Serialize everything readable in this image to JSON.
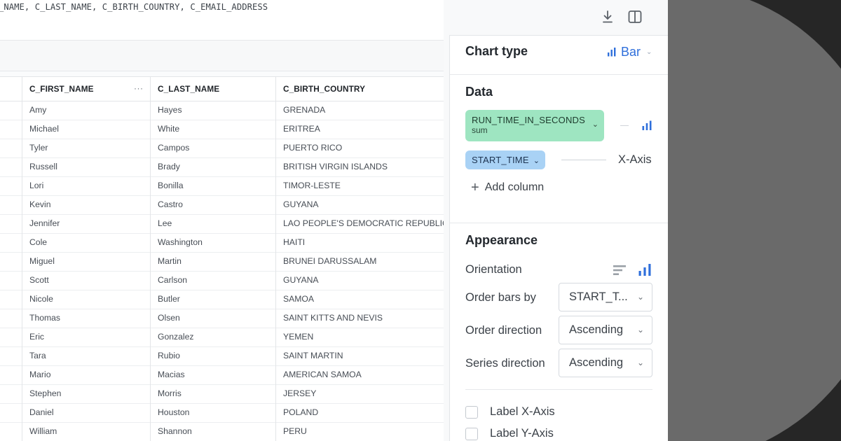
{
  "sql": {
    "text": "_NAME, C_LAST_NAME, C_BIRTH_COUNTRY, C_EMAIL_ADDRESS"
  },
  "table": {
    "columns": [
      "C_FIRST_NAME",
      "C_LAST_NAME",
      "C_BIRTH_COUNTRY"
    ],
    "rows": [
      [
        "Amy",
        "Hayes",
        "GRENADA"
      ],
      [
        "Michael",
        "White",
        "ERITREA"
      ],
      [
        "Tyler",
        "Campos",
        "PUERTO RICO"
      ],
      [
        "Russell",
        "Brady",
        "BRITISH VIRGIN ISLANDS"
      ],
      [
        "Lori",
        "Bonilla",
        "TIMOR-LESTE"
      ],
      [
        "Kevin",
        "Castro",
        "GUYANA"
      ],
      [
        "Jennifer",
        "Lee",
        "LAO PEOPLE'S DEMOCRATIC REPUBLIC"
      ],
      [
        "Cole",
        "Washington",
        "HAITI"
      ],
      [
        "Miguel",
        "Martin",
        "BRUNEI DARUSSALAM"
      ],
      [
        "Scott",
        "Carlson",
        "GUYANA"
      ],
      [
        "Nicole",
        "Butler",
        "SAMOA"
      ],
      [
        "Thomas",
        "Olsen",
        "SAINT KITTS AND NEVIS"
      ],
      [
        "Eric",
        "Gonzalez",
        "YEMEN"
      ],
      [
        "Tara",
        "Rubio",
        "SAINT MARTIN"
      ],
      [
        "Mario",
        "Macias",
        "AMERICAN SAMOA"
      ],
      [
        "Stephen",
        "Morris",
        "JERSEY"
      ],
      [
        "Daniel",
        "Houston",
        "POLAND"
      ],
      [
        "William",
        "Shannon",
        "PERU"
      ]
    ]
  },
  "panel": {
    "chart_type": {
      "label": "Chart type",
      "value": "Bar",
      "icon": "bar-chart-icon"
    },
    "data": {
      "title": "Data",
      "series": {
        "name": "RUN_TIME_IN_SECONDS",
        "aggregation": "sum",
        "color": "#9ee5c1"
      },
      "x_axis": {
        "name": "START_TIME",
        "role": "X-Axis",
        "color": "#a9d2f5"
      },
      "add_column": "Add column"
    },
    "appearance": {
      "title": "Appearance",
      "orientation_label": "Orientation",
      "order_bars_by": {
        "label": "Order bars by",
        "value": "START_T..."
      },
      "order_direction": {
        "label": "Order direction",
        "value": "Ascending"
      },
      "series_direction": {
        "label": "Series direction",
        "value": "Ascending"
      },
      "checkboxes": [
        {
          "label": "Label X-Axis",
          "checked": false
        },
        {
          "label": "Label Y-Axis",
          "checked": false
        }
      ]
    }
  },
  "colors": {
    "accent": "#2f6fdb",
    "backdrop": "#262626",
    "backdrop_circle": "#6a6a6a"
  }
}
